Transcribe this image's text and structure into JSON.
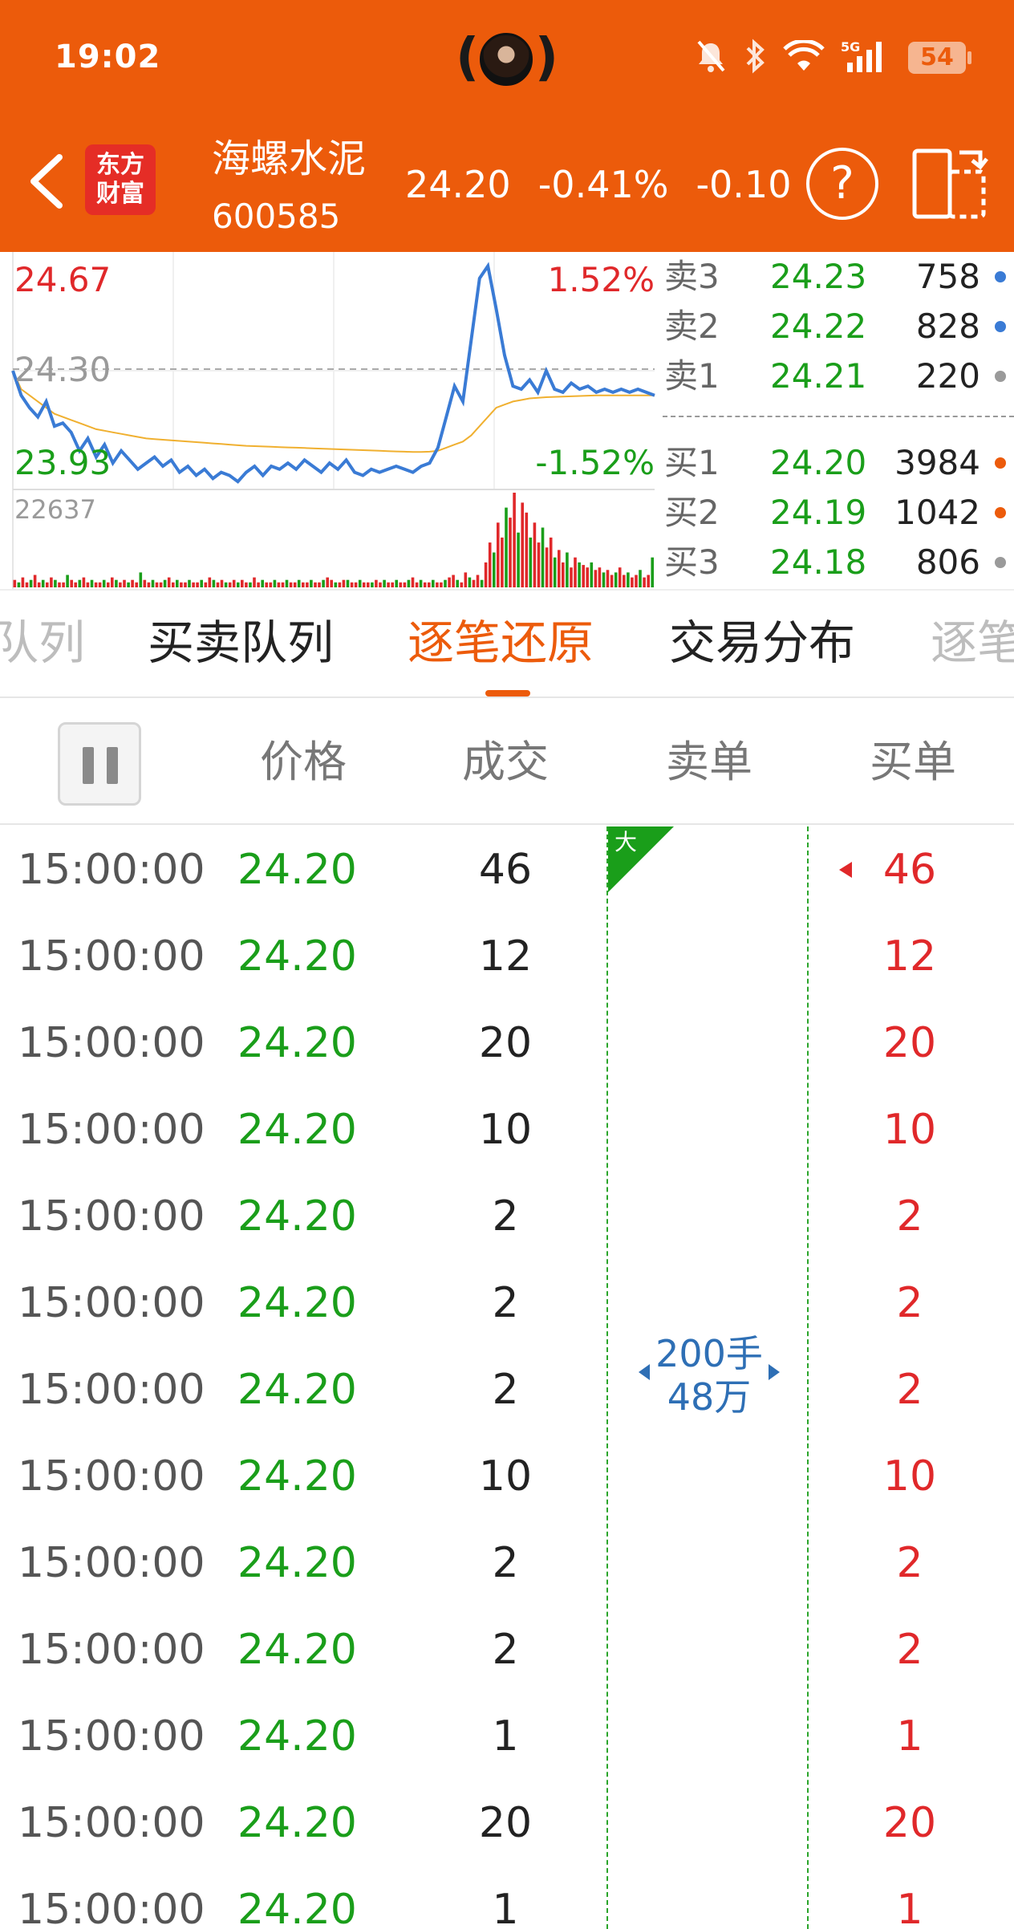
{
  "status_bar": {
    "time": "19:02",
    "battery": "54",
    "network": "5G"
  },
  "app": {
    "logo_line1": "东方",
    "logo_line2": "财富"
  },
  "stock": {
    "name": "海螺水泥",
    "code": "600585",
    "price": "24.20",
    "change_pct": "-0.41%",
    "change": "-0.10"
  },
  "chart": {
    "high_price": "24.67",
    "high_pct": "1.52%",
    "prev_close": "24.30",
    "low_price": "23.93",
    "low_pct": "-1.52%",
    "volume_max": "22637"
  },
  "chart_data": {
    "type": "line",
    "title": "",
    "ylim": [
      23.93,
      24.67
    ],
    "series": [
      {
        "values": [
          24.3,
          24.22,
          24.18,
          24.15,
          24.2,
          24.12,
          24.13,
          24.1,
          24.04,
          24.08,
          24.02,
          24.06,
          24.0,
          24.04,
          24.01,
          23.98,
          24.0,
          24.02,
          23.99,
          24.01,
          23.97,
          23.99,
          23.96,
          23.98,
          23.95,
          23.97,
          23.96,
          23.94,
          23.97,
          23.99,
          23.96,
          23.99,
          23.98,
          24.0,
          23.98,
          24.01,
          23.99,
          23.97,
          24.0,
          23.98,
          24.01,
          23.97,
          23.96,
          23.98,
          23.97,
          23.98,
          23.99,
          23.98,
          23.97,
          23.99,
          24.0,
          24.05,
          24.15,
          24.25,
          24.2,
          24.4,
          24.6,
          24.64,
          24.5,
          24.35,
          24.25,
          24.24,
          24.27,
          24.23,
          24.3,
          24.24,
          24.23,
          24.26,
          24.24,
          24.25,
          24.23,
          24.24,
          24.23,
          24.24,
          24.23,
          24.24,
          24.23,
          24.22
        ]
      },
      {
        "values": [
          24.3,
          24.24,
          24.22,
          24.2,
          24.18,
          24.16,
          24.15,
          24.14,
          24.13,
          24.12,
          24.11,
          24.105,
          24.1,
          24.095,
          24.09,
          24.085,
          24.08,
          24.078,
          24.076,
          24.074,
          24.072,
          24.07,
          24.068,
          24.066,
          24.064,
          24.062,
          24.06,
          24.058,
          24.056,
          24.055,
          24.054,
          24.053,
          24.052,
          24.051,
          24.05,
          24.049,
          24.048,
          24.047,
          24.046,
          24.045,
          24.044,
          24.043,
          24.042,
          24.041,
          24.04,
          24.039,
          24.038,
          24.037,
          24.036,
          24.036,
          24.037,
          24.04,
          24.05,
          24.06,
          24.07,
          24.09,
          24.12,
          24.15,
          24.18,
          24.19,
          24.2,
          24.205,
          24.21,
          24.212,
          24.214,
          24.215,
          24.216,
          24.217,
          24.218,
          24.219,
          24.22,
          24.22,
          24.22,
          24.22,
          24.22,
          24.22,
          24.22,
          24.22
        ]
      }
    ],
    "volumes": [
      3,
      2,
      4,
      2,
      3,
      5,
      2,
      3,
      2,
      4,
      3,
      2,
      2,
      5,
      3,
      2,
      3,
      4,
      2,
      3,
      2,
      2,
      3,
      2,
      4,
      3,
      2,
      3,
      2,
      3,
      2,
      6,
      3,
      2,
      3,
      2,
      2,
      3,
      4,
      2,
      3,
      2,
      2,
      3,
      2,
      2,
      3,
      2,
      4,
      3,
      2,
      3,
      2,
      2,
      3,
      2,
      3,
      2,
      2,
      4,
      2,
      3,
      2,
      2,
      3,
      2,
      2,
      3,
      2,
      2,
      3,
      2,
      2,
      3,
      2,
      2,
      3,
      4,
      3,
      2,
      2,
      3,
      3,
      2,
      2,
      3,
      2,
      2,
      2,
      3,
      2,
      3,
      2,
      2,
      3,
      2,
      2,
      3,
      4,
      2,
      3,
      2,
      2,
      3,
      2,
      2,
      3,
      4,
      5,
      3,
      2,
      6,
      4,
      3,
      5,
      3,
      10,
      18,
      14,
      26,
      20,
      32,
      28,
      38,
      22,
      34,
      30,
      20,
      26,
      18,
      24,
      16,
      20,
      12,
      15,
      10,
      14,
      8,
      12,
      10,
      9,
      8,
      10,
      7,
      8,
      6,
      7,
      5,
      6,
      8,
      5,
      6,
      4,
      5,
      7,
      4,
      5,
      12
    ]
  },
  "orderbook": {
    "sells": [
      {
        "label": "卖3",
        "price": "24.23",
        "volume": "758"
      },
      {
        "label": "卖2",
        "price": "24.22",
        "volume": "828"
      },
      {
        "label": "卖1",
        "price": "24.21",
        "volume": "220"
      }
    ],
    "buys": [
      {
        "label": "买1",
        "price": "24.20",
        "volume": "3984"
      },
      {
        "label": "买2",
        "price": "24.19",
        "volume": "1042"
      },
      {
        "label": "买3",
        "price": "24.18",
        "volume": "806"
      }
    ],
    "dot_colors": [
      "#3A7BD5",
      "#3A7BD5",
      "#9a9a9a",
      "#EC5B0B",
      "#EC5B0B",
      "#9a9a9a"
    ]
  },
  "tabs": [
    "队列",
    "买卖队列",
    "逐笔还原",
    "交易分布",
    "逐笔"
  ],
  "list_header": {
    "price": "价格",
    "deal": "成交",
    "sell": "卖单",
    "buy": "买单"
  },
  "big_order": {
    "flag": "大",
    "hands": "200手",
    "amount": "48万"
  },
  "trades": [
    {
      "time": "15:00:00",
      "price": "24.20",
      "volume": "46",
      "buy": "46"
    },
    {
      "time": "15:00:00",
      "price": "24.20",
      "volume": "12",
      "buy": "12"
    },
    {
      "time": "15:00:00",
      "price": "24.20",
      "volume": "20",
      "buy": "20"
    },
    {
      "time": "15:00:00",
      "price": "24.20",
      "volume": "10",
      "buy": "10"
    },
    {
      "time": "15:00:00",
      "price": "24.20",
      "volume": "2",
      "buy": "2"
    },
    {
      "time": "15:00:00",
      "price": "24.20",
      "volume": "2",
      "buy": "2"
    },
    {
      "time": "15:00:00",
      "price": "24.20",
      "volume": "2",
      "buy": "2"
    },
    {
      "time": "15:00:00",
      "price": "24.20",
      "volume": "10",
      "buy": "10"
    },
    {
      "time": "15:00:00",
      "price": "24.20",
      "volume": "2",
      "buy": "2"
    },
    {
      "time": "15:00:00",
      "price": "24.20",
      "volume": "2",
      "buy": "2"
    },
    {
      "time": "15:00:00",
      "price": "24.20",
      "volume": "1",
      "buy": "1"
    },
    {
      "time": "15:00:00",
      "price": "24.20",
      "volume": "20",
      "buy": "20"
    },
    {
      "time": "15:00:00",
      "price": "24.20",
      "volume": "1",
      "buy": "1"
    }
  ],
  "colors": {
    "brand": "#EC5B0B",
    "up": "#E0282A",
    "down": "#1A9E1A",
    "price_line": "#3A7BD5",
    "avg_line": "#F0B030"
  }
}
